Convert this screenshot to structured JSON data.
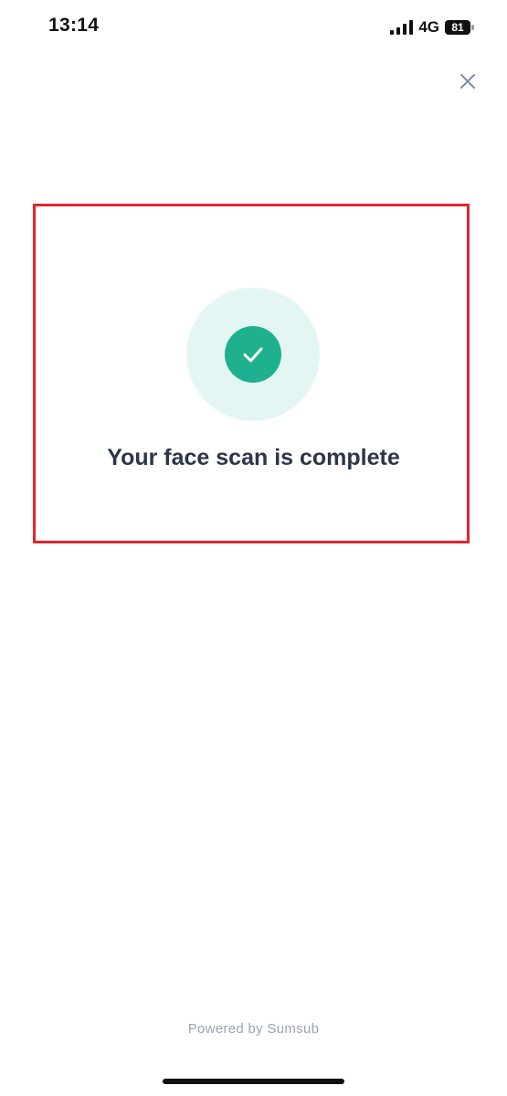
{
  "status_bar": {
    "time": "13:14",
    "network": "4G",
    "battery": "81",
    "signal_icon": "cellular-signal-icon",
    "battery_icon": "battery-icon"
  },
  "header": {
    "close_icon": "close-icon"
  },
  "result": {
    "title": "Your face scan is complete",
    "icon": "checkmark-icon",
    "accent_color": "#1fb18f",
    "highlight_color": "#e32531"
  },
  "footer": {
    "powered_by": "Powered by Sumsub"
  }
}
